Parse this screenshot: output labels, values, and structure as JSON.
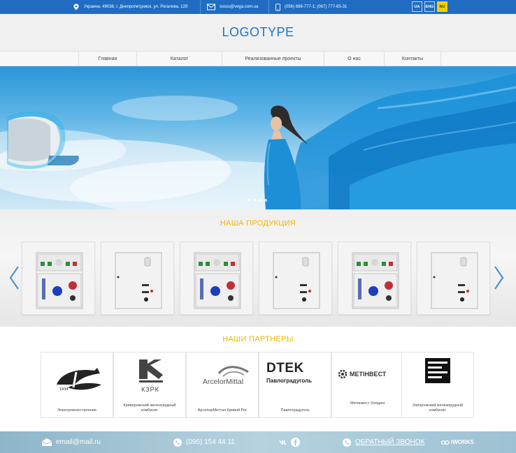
{
  "topbar": {
    "address": "Украина, 49038, г. Днепропетровск, ул. Рогалева, 12б",
    "email": "sssss@vega.com.ua",
    "phones": "(056) 888-777-1; (067) 777-65-31",
    "languages": [
      {
        "label": "UA",
        "active": false
      },
      {
        "label": "ENG",
        "active": false
      },
      {
        "label": "RU",
        "active": true
      }
    ]
  },
  "header": {
    "logo": "LOGOTYPE"
  },
  "nav": {
    "items": [
      "Главная",
      "Каталог",
      "Реализованные проекты",
      "О нас",
      "Контакты"
    ]
  },
  "hero": {
    "slides": 4,
    "active_slide": 1
  },
  "products": {
    "title": "НАША ПРОДУКЦИЯ",
    "cards": [
      "control-panel",
      "electrical-box",
      "control-panel",
      "electrical-box",
      "control-panel",
      "electrical-box"
    ]
  },
  "partners": {
    "title": "НАШИ ПАРТНЕРЫ",
    "items": [
      {
        "logo": "",
        "caption": "Электровозостроение"
      },
      {
        "logo": "КЗРК",
        "caption": "Криворожский железорудный комбинат"
      },
      {
        "logo": "ArcelorMittal",
        "caption": "АрселорМиттал Кривой Рог"
      },
      {
        "logo": "DTEK",
        "sublogo": "Павлоградуголь",
        "caption": "Павлоградуголь"
      },
      {
        "logo": "МЕТІНВЕСТ",
        "caption": "Метинвест Холдинг"
      },
      {
        "logo": "",
        "caption": "Запорожский железорудный комбинат"
      }
    ]
  },
  "footer": {
    "email": "email@mail.ru",
    "phone": "(095) 154 44 11",
    "callback": "ОБРАТНЫЙ ЗВОНОК",
    "brand": "IWORKS"
  },
  "colors": {
    "topbar": "#1f6cc2",
    "accent": "#f1b500",
    "logo": "#2073c8",
    "lang_active": "#f3d000"
  }
}
